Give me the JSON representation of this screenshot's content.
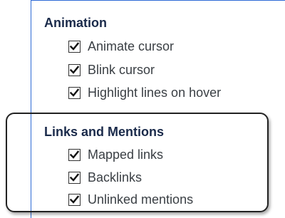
{
  "sections": [
    {
      "heading": "Animation",
      "options": [
        {
          "label": "Animate cursor",
          "checked": true
        },
        {
          "label": "Blink cursor",
          "checked": true
        },
        {
          "label": "Highlight lines on hover",
          "checked": true
        }
      ]
    },
    {
      "heading": "Links and Mentions",
      "options": [
        {
          "label": "Mapped links",
          "checked": true
        },
        {
          "label": "Backlinks",
          "checked": true
        },
        {
          "label": "Unlinked mentions",
          "checked": true
        }
      ]
    }
  ],
  "colors": {
    "panel_border": "#2f6bd6",
    "heading_text": "#1a2a4a",
    "option_text": "#3a3f44"
  }
}
